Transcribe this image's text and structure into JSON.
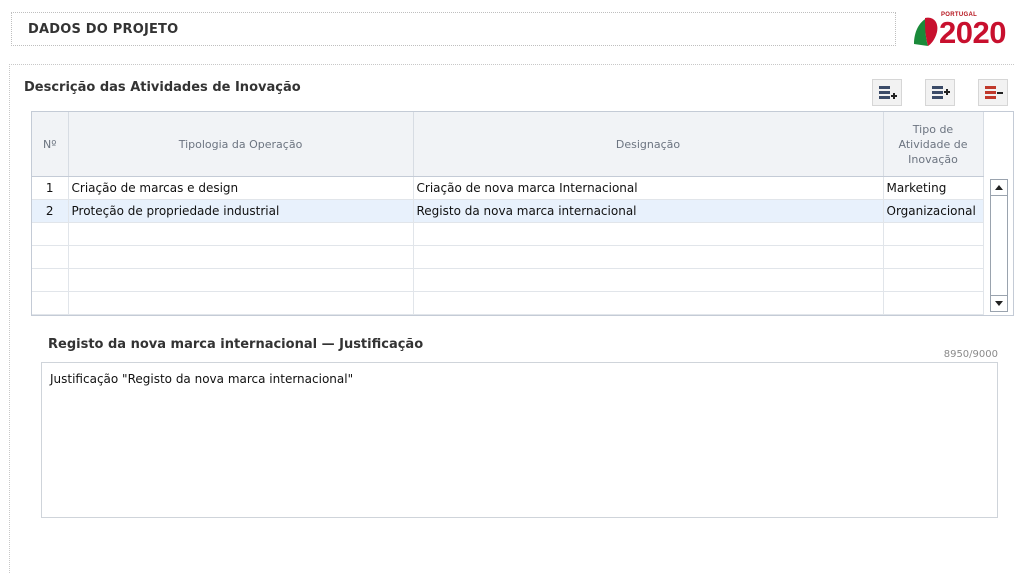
{
  "header": {
    "title": "DADOS DO PROJETO"
  },
  "logo": {
    "small_text": "PORTUGAL",
    "big_text": "2020"
  },
  "section": {
    "title": "Descrição das Atividades de Inovação"
  },
  "toolbar": {
    "buttons": [
      {
        "icon": "add-row-icon"
      },
      {
        "icon": "insert-row-icon"
      },
      {
        "icon": "remove-row-icon"
      }
    ]
  },
  "table": {
    "columns": [
      "Nº",
      "Tipologia da Operação",
      "Designação",
      "Tipo de Atividade de Inovação"
    ],
    "rows": [
      {
        "num": "1",
        "tipologia": "Criação de marcas e design",
        "designacao": "Criação de nova marca Internacional",
        "tipo": "Marketing"
      },
      {
        "num": "2",
        "tipologia": "Proteção de propriedade industrial",
        "designacao": "Registo da nova marca internacional",
        "tipo": "Organizacional"
      }
    ],
    "selected_row": 2
  },
  "justification": {
    "title": "Registo da nova marca internacional — Justificação",
    "counter": "8950/9000",
    "text": "Justificação \"Registo da nova marca internacional\""
  },
  "colors": {
    "logo_red": "#c8102e",
    "logo_green": "#1a8a3a",
    "selected_row_bg": "#e8f1fc",
    "remove_icon": "#c0392b"
  }
}
